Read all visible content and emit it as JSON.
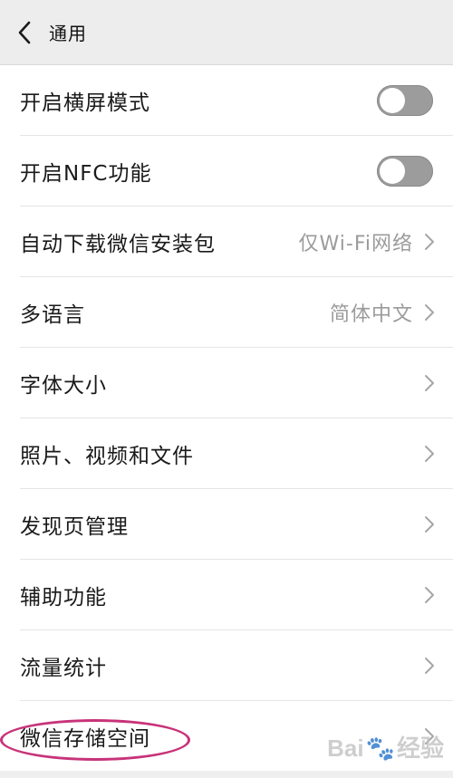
{
  "header": {
    "title": "通用",
    "back_icon": "chevron-left-icon"
  },
  "settings": [
    {
      "label": "开启横屏模式",
      "type": "toggle",
      "on": false
    },
    {
      "label": "开启NFC功能",
      "type": "toggle",
      "on": false
    },
    {
      "label": "自动下载微信安装包",
      "type": "value",
      "value": "仅Wi-Fi网络"
    },
    {
      "label": "多语言",
      "type": "value",
      "value": "简体中文"
    },
    {
      "label": "字体大小",
      "type": "link"
    },
    {
      "label": "照片、视频和文件",
      "type": "link"
    },
    {
      "label": "发现页管理",
      "type": "link"
    },
    {
      "label": "辅助功能",
      "type": "link"
    },
    {
      "label": "流量统计",
      "type": "link"
    },
    {
      "label": "微信存储空间",
      "type": "link",
      "highlighted": true
    }
  ],
  "colors": {
    "header_bg": "#ededed",
    "toggle_off": "#9c9c9c",
    "highlight": "#c8337a",
    "value_text": "#9b9b9b"
  },
  "watermark": {
    "text_left": "Bai",
    "text_right": "经验",
    "icon": "baidu-paw-icon"
  }
}
